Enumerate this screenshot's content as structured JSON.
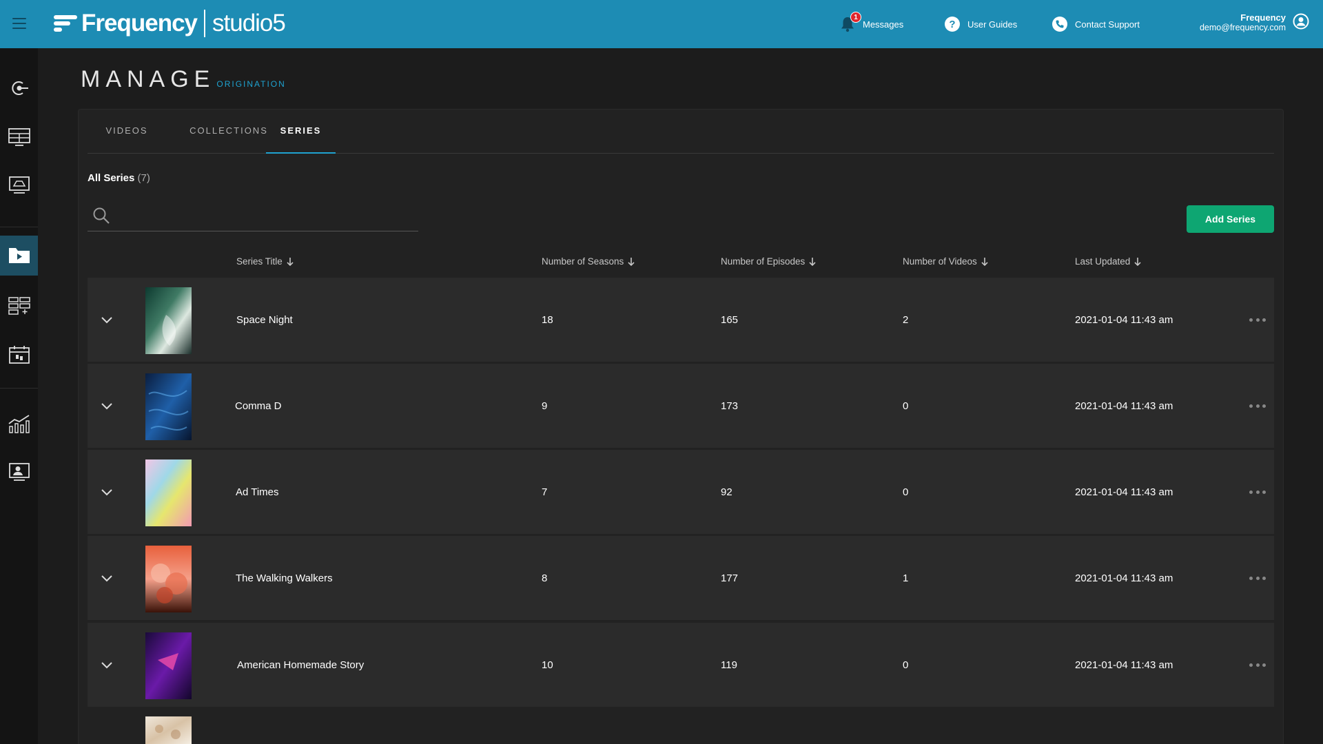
{
  "header": {
    "brand_name": "Frequency",
    "product_name": "studio5",
    "messages_label": "Messages",
    "messages_badge": "1",
    "guides_label": "User Guides",
    "support_label": "Contact Support",
    "user_name": "Frequency",
    "user_email": "demo@frequency.com"
  },
  "page": {
    "title": "MANAGE",
    "subtitle": "ORIGINATION"
  },
  "tabs": [
    {
      "label": "VIDEOS",
      "active": false
    },
    {
      "label": "COLLECTIONS",
      "active": false
    },
    {
      "label": "SERIES",
      "active": true
    }
  ],
  "list": {
    "heading": "All Series",
    "count": "(7)",
    "search_placeholder": "",
    "add_button": "Add Series"
  },
  "columns": {
    "title": "Series Title",
    "seasons": "Number of Seasons",
    "episodes": "Number of Episodes",
    "videos": "Number of Videos",
    "updated": "Last Updated"
  },
  "rows": [
    {
      "title": "Space Night",
      "seasons": "18",
      "episodes": "165",
      "videos": "2",
      "updated": "2021-01-04 11:43 am"
    },
    {
      "title": "Comma D",
      "seasons": "9",
      "episodes": "173",
      "videos": "0",
      "updated": "2021-01-04 11:43 am"
    },
    {
      "title": "Ad Times",
      "seasons": "7",
      "episodes": "92",
      "videos": "0",
      "updated": "2021-01-04 11:43 am"
    },
    {
      "title": "The Walking Walkers",
      "seasons": "8",
      "episodes": "177",
      "videos": "1",
      "updated": "2021-01-04 11:43 am"
    },
    {
      "title": "American Homemade Story",
      "seasons": "10",
      "episodes": "119",
      "videos": "0",
      "updated": "2021-01-04 11:43 am"
    }
  ],
  "colors": {
    "header_bg": "#1d8cb4",
    "accent": "#1fa3d1",
    "add_button": "#0ea672",
    "sidebar_active": "#1d4e62"
  },
  "icons": {
    "sidebar": [
      "origination-icon",
      "grid-layout-icon",
      "monitor-icon",
      "video-folder-icon",
      "add-layout-icon",
      "calendar-icon",
      "analytics-icon",
      "user-badge-icon"
    ]
  }
}
